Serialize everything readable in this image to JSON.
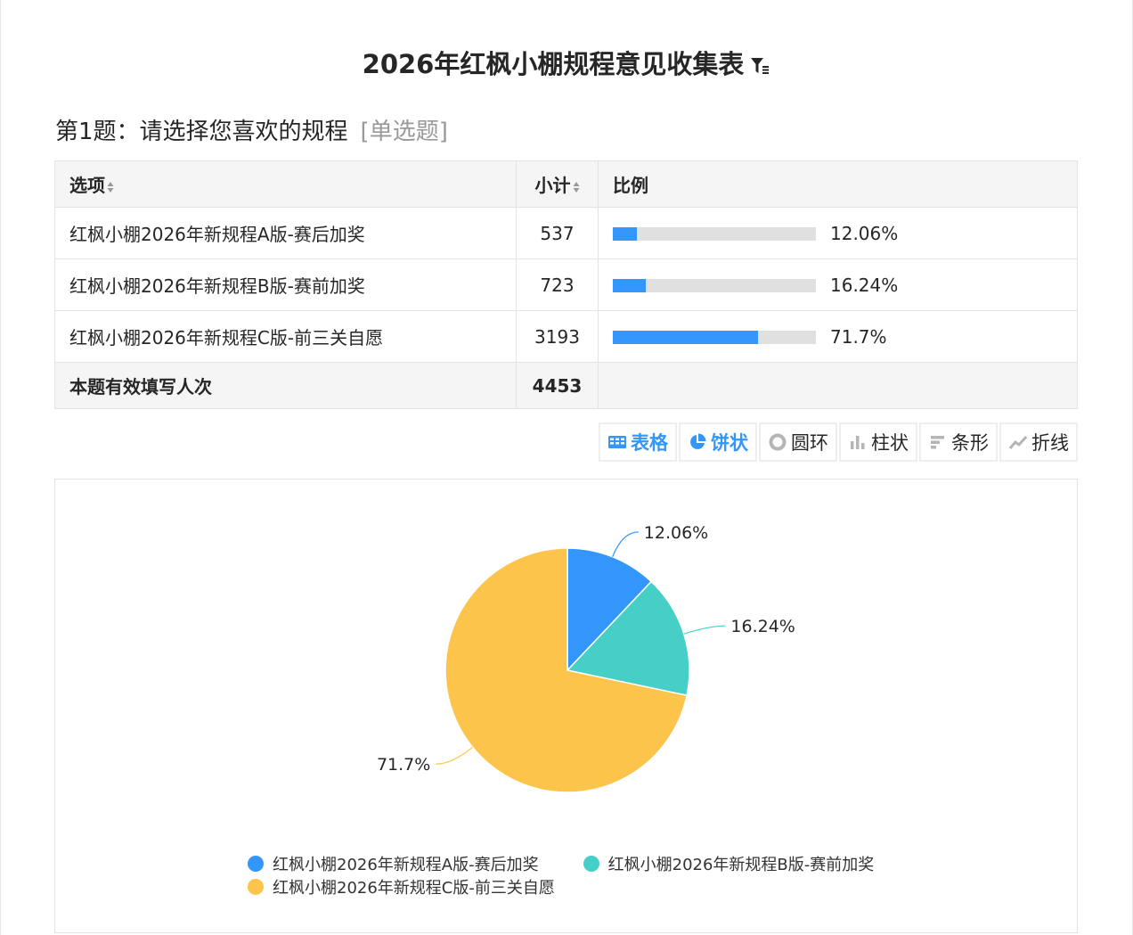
{
  "page_title": "2026年红枫小棚规程意见收集表",
  "question": {
    "label": "第1题：请选择您喜欢的规程",
    "type": "[单选题]"
  },
  "table": {
    "headers": {
      "option": "选项",
      "count": "小计",
      "ratio": "比例"
    },
    "rows": [
      {
        "option": "红枫小棚2026年新规程A版-赛后加奖",
        "count": "537",
        "ratio": "12.06%",
        "ratio_value": 12.06
      },
      {
        "option": "红枫小棚2026年新规程B版-赛前加奖",
        "count": "723",
        "ratio": "16.24%",
        "ratio_value": 16.24
      },
      {
        "option": "红枫小棚2026年新规程C版-前三关自愿",
        "count": "3193",
        "ratio": "71.7%",
        "ratio_value": 71.7
      }
    ],
    "total_label": "本题有效填写人次",
    "total_value": "4453"
  },
  "toolbar": {
    "items": [
      {
        "label": "表格",
        "icon": "table-icon",
        "active": true
      },
      {
        "label": "饼状",
        "icon": "pie-icon",
        "active": true
      },
      {
        "label": "圆环",
        "icon": "donut-icon",
        "active": false
      },
      {
        "label": "柱状",
        "icon": "bar-icon",
        "active": false
      },
      {
        "label": "条形",
        "icon": "hbar-icon",
        "active": false
      },
      {
        "label": "折线",
        "icon": "line-icon",
        "active": false
      }
    ]
  },
  "colors": {
    "accent": "#3296fa",
    "series": [
      "#3296fa",
      "#45cfc6",
      "#fcc44a"
    ]
  },
  "chart_data": {
    "type": "pie",
    "categories": [
      "红枫小棚2026年新规程A版-赛后加奖",
      "红枫小棚2026年新规程B版-赛前加奖",
      "红枫小棚2026年新规程C版-前三关自愿"
    ],
    "values": [
      12.06,
      16.24,
      71.7
    ],
    "labels": [
      "12.06%",
      "16.24%",
      "71.7%"
    ],
    "legend_position": "bottom"
  }
}
